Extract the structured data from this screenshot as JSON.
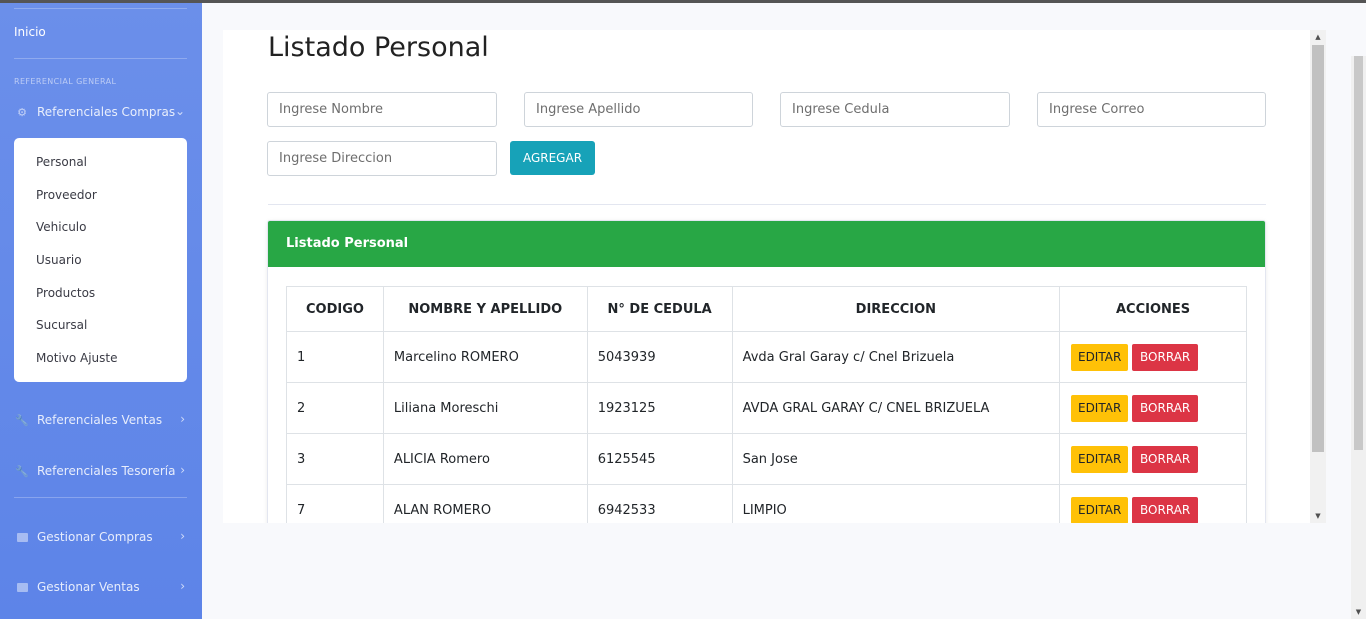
{
  "sidebar": {
    "inicio": "Inicio",
    "heading": "REFERENCIAL GENERAL",
    "referenciales_compras": "Referenciales Compras",
    "submenu": [
      "Personal",
      "Proveedor",
      "Vehiculo",
      "Usuario",
      "Productos",
      "Sucursal",
      "Motivo Ajuste"
    ],
    "referenciales_ventas": "Referenciales Ventas",
    "referenciales_tesoreria": "Referenciales Tesorería",
    "gestionar_compras": "Gestionar Compras",
    "gestionar_ventas": "Gestionar Ventas"
  },
  "main": {
    "title": "Listado Personal",
    "form": {
      "nombre_placeholder": "Ingrese Nombre",
      "apellido_placeholder": "Ingrese Apellido",
      "cedula_placeholder": "Ingrese Cedula",
      "correo_placeholder": "Ingrese Correo",
      "direccion_placeholder": "Ingrese Direccion",
      "agregar_label": "AGREGAR"
    },
    "panel_title": "Listado Personal",
    "table": {
      "headers": [
        "CODIGO",
        "NOMBRE Y APELLIDO",
        "N° DE CEDULA",
        "DIRECCION",
        "ACCIONES"
      ],
      "rows": [
        [
          "1",
          "Marcelino ROMERO",
          "5043939",
          "Avda Gral Garay c/ Cnel Brizuela"
        ],
        [
          "2",
          "Liliana Moreschi",
          "1923125",
          "AVDA GRAL GARAY C/ CNEL BRIZUELA"
        ],
        [
          "3",
          "ALICIA Romero",
          "6125545",
          "San Jose"
        ],
        [
          "7",
          "ALAN ROMERO",
          "6942533",
          "LIMPIO"
        ]
      ],
      "edit_label": "EDITAR",
      "delete_label": "BORRAR"
    }
  },
  "colors": {
    "sidebar": "#6b8fea",
    "panel_header": "#28a745",
    "agregar": "#17a2b8",
    "editar": "#ffc107",
    "borrar": "#dc3545"
  }
}
